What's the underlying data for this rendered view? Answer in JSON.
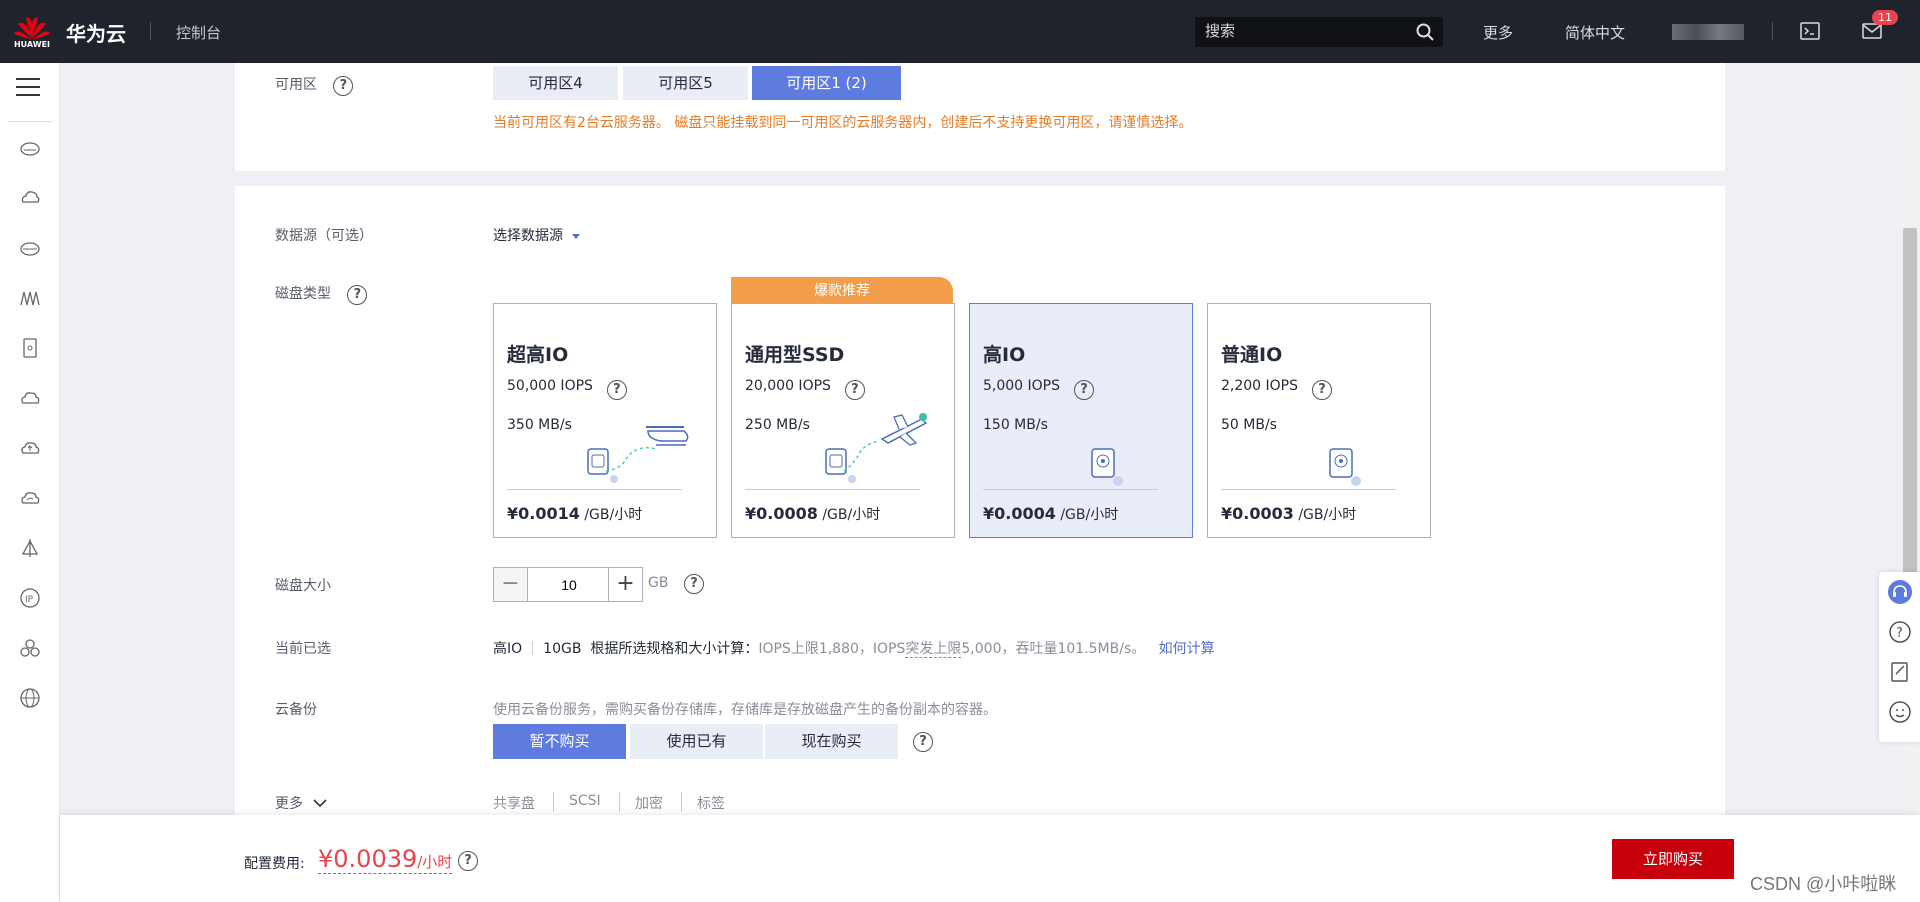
{
  "header": {
    "brand": "华为云",
    "logo_text": "HUAWEI",
    "console": "控制台",
    "search_placeholder": "搜索",
    "more": "更多",
    "lang": "简体中文",
    "mail_badge": "11"
  },
  "az": {
    "label": "可用区",
    "options": [
      "可用区4",
      "可用区5",
      "可用区1 (2)"
    ],
    "selected": "可用区1 (2)",
    "warning": "当前可用区有2台云服务器。 磁盘只能挂载到同一可用区的云服务器内，创建后不支持更换可用区，请谨慎选择。"
  },
  "datasource": {
    "label": "数据源（可选）",
    "link": "选择数据源"
  },
  "disk_type": {
    "label": "磁盘类型",
    "ribbon": "爆款推荐",
    "price_unit": "/GB/小时",
    "cards": [
      {
        "name": "超高IO",
        "iops": "50,000 IOPS",
        "throughput": "350 MB/s",
        "price": "¥0.0014"
      },
      {
        "name": "通用型SSD",
        "iops": "20,000 IOPS",
        "throughput": "250 MB/s",
        "price": "¥0.0008"
      },
      {
        "name": "高IO",
        "iops": "5,000 IOPS",
        "throughput": "150 MB/s",
        "price": "¥0.0004"
      },
      {
        "name": "普通IO",
        "iops": "2,200 IOPS",
        "throughput": "50 MB/s",
        "price": "¥0.0003"
      }
    ],
    "selected": "高IO"
  },
  "disk_size": {
    "label": "磁盘大小",
    "value": "10",
    "unit": "GB"
  },
  "current": {
    "label": "当前已选",
    "type": "高IO",
    "size": "10GB",
    "desc_prefix": "根据所选规格和大小计算：",
    "desc_a": "IOPS上限1,880，IOPS",
    "desc_b": "突发上限",
    "desc_c": "5,000，吞吐量101.5MB/s。",
    "how": "如何计算"
  },
  "backup": {
    "label": "云备份",
    "desc": "使用云备份服务，需购买备份存储库，存储库是存放磁盘产生的备份副本的容器。",
    "options": [
      "暂不购买",
      "使用已有",
      "现在购买"
    ],
    "selected": "暂不购买"
  },
  "more": {
    "label": "更多",
    "items": [
      "共享盘",
      "SCSI",
      "加密",
      "标签"
    ]
  },
  "footer": {
    "fee_label": "配置费用:",
    "fee_value": "¥0.0039",
    "fee_unit": "/小时",
    "buy": "立即购买",
    "watermark": "CSDN @小咔啦眯"
  },
  "colors": {
    "primary": "#5e7ce0",
    "buy": "#c7000b",
    "warning": "#e37d29",
    "ribbon": "#f29d4a",
    "price": "#e8444e"
  }
}
